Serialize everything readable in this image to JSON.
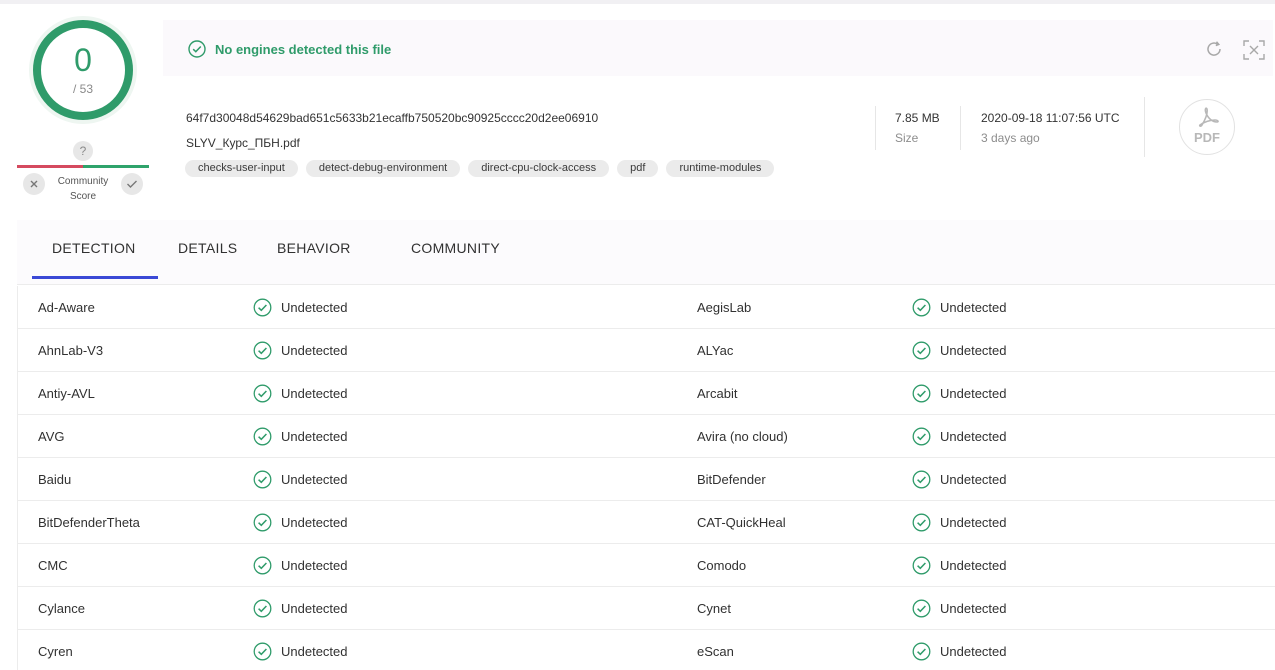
{
  "score": {
    "detected": "0",
    "total": "/ 53"
  },
  "community": {
    "question": "?",
    "label_line1": "Community",
    "label_line2": "Score"
  },
  "banner": {
    "message": "No engines detected this file"
  },
  "file": {
    "hash": "64f7d30048d54629bad651c5633b21ecaffb750520bc90925cccc20d2ee06910",
    "name": "SLYV_Курс_ПБН.pdf",
    "tags": [
      "checks-user-input",
      "detect-debug-environment",
      "direct-cpu-clock-access",
      "pdf",
      "runtime-modules"
    ],
    "size_value": "7.85 MB",
    "size_label": "Size",
    "date_value": "2020-09-18 11:07:56 UTC",
    "date_ago": "3 days ago",
    "type_icon_text": "PDF"
  },
  "tabs": [
    {
      "label": "DETECTION"
    },
    {
      "label": "DETAILS"
    },
    {
      "label": "BEHAVIOR"
    },
    {
      "label": "COMMUNITY"
    }
  ],
  "detections": [
    {
      "left": {
        "engine": "Ad-Aware",
        "result": "Undetected"
      },
      "right": {
        "engine": "AegisLab",
        "result": "Undetected"
      }
    },
    {
      "left": {
        "engine": "AhnLab-V3",
        "result": "Undetected"
      },
      "right": {
        "engine": "ALYac",
        "result": "Undetected"
      }
    },
    {
      "left": {
        "engine": "Antiy-AVL",
        "result": "Undetected"
      },
      "right": {
        "engine": "Arcabit",
        "result": "Undetected"
      }
    },
    {
      "left": {
        "engine": "AVG",
        "result": "Undetected"
      },
      "right": {
        "engine": "Avira (no cloud)",
        "result": "Undetected"
      }
    },
    {
      "left": {
        "engine": "Baidu",
        "result": "Undetected"
      },
      "right": {
        "engine": "BitDefender",
        "result": "Undetected"
      }
    },
    {
      "left": {
        "engine": "BitDefenderTheta",
        "result": "Undetected"
      },
      "right": {
        "engine": "CAT-QuickHeal",
        "result": "Undetected"
      }
    },
    {
      "left": {
        "engine": "CMC",
        "result": "Undetected"
      },
      "right": {
        "engine": "Comodo",
        "result": "Undetected"
      }
    },
    {
      "left": {
        "engine": "Cylance",
        "result": "Undetected"
      },
      "right": {
        "engine": "Cynet",
        "result": "Undetected"
      }
    },
    {
      "left": {
        "engine": "Cyren",
        "result": "Undetected"
      },
      "right": {
        "engine": "eScan",
        "result": "Undetected"
      }
    }
  ],
  "colors": {
    "clean": "#2f9b6a",
    "tab_active": "#3b49d6",
    "negative": "#d54a5f"
  },
  "icons": {
    "ok": "check-circle-icon",
    "refresh": "refresh-icon",
    "fullscreen": "expand-icon",
    "vote_bad": "close-icon",
    "vote_good": "check-icon",
    "file_type": "pdf-file-icon"
  }
}
